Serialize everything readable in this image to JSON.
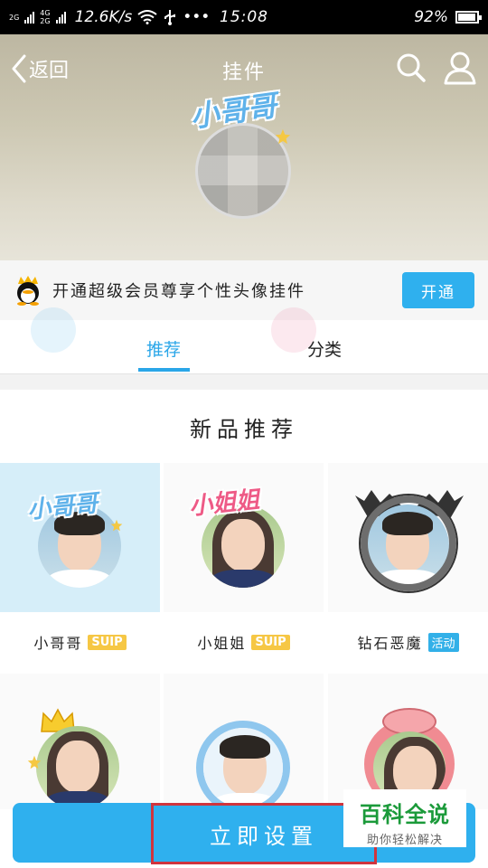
{
  "status_bar": {
    "net_type_top": "2G",
    "net_type_4g": "4G",
    "net_type_2g": "2G",
    "speed": "12.6K/s",
    "dots": "•••",
    "time": "15:08",
    "battery": "92%"
  },
  "nav": {
    "back_label": "返回",
    "title": "挂件"
  },
  "preview": {
    "pendant_text": "小哥哥"
  },
  "vip_banner": {
    "text": "开通超级会员尊享个性头像挂件",
    "button": "开通"
  },
  "tabs": [
    {
      "label": "推荐",
      "active": true
    },
    {
      "label": "分类",
      "active": false
    }
  ],
  "section_title": "新品推荐",
  "items": [
    {
      "name": "小哥哥",
      "badge": "SUIP",
      "badge_type": "suip",
      "selected": true,
      "pendant_text": "小哥哥"
    },
    {
      "name": "小姐姐",
      "badge": "SUIP",
      "badge_type": "suip",
      "selected": false,
      "pendant_text": "小姐姐"
    },
    {
      "name": "钻石恶魔",
      "badge": "活动",
      "badge_type": "event",
      "selected": false,
      "pendant_text": ""
    }
  ],
  "bottom": {
    "set_button": "立即设置"
  },
  "watermark": {
    "title": "百科全说",
    "subtitle": "助你轻松解决"
  },
  "colors": {
    "accent": "#2fb0ee",
    "tab_active": "#2aa6e8",
    "badge_suip": "#f6c744",
    "highlight_border": "#d0343d"
  }
}
